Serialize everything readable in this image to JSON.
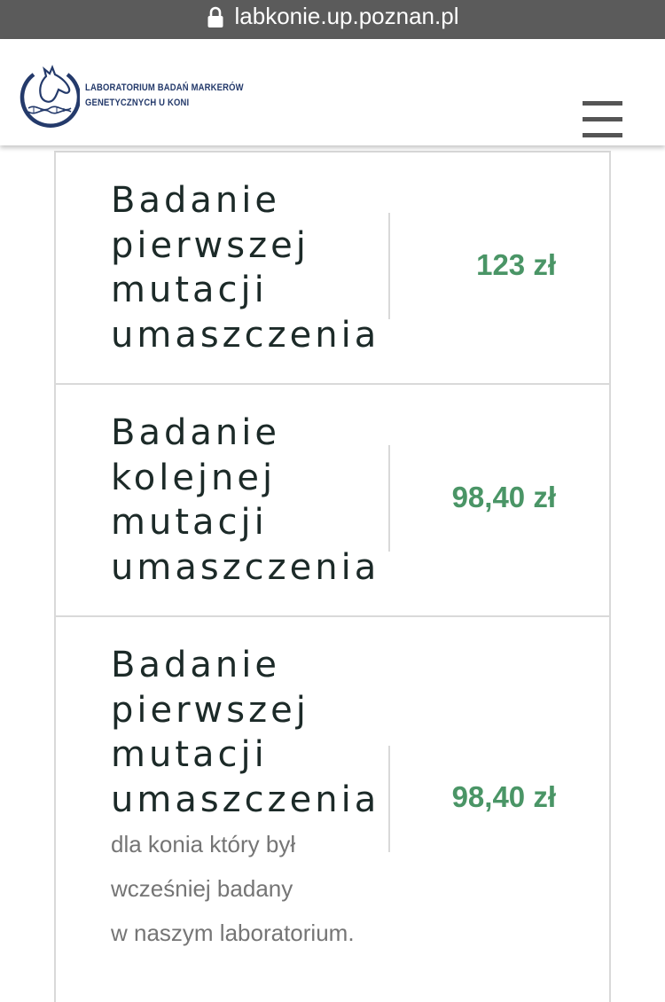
{
  "browser": {
    "url": "labkonie.up.poznan.pl"
  },
  "header": {
    "logo_line1": "LABORATORIUM BADAŃ MARKERÓW",
    "logo_line2": "GENETYCZNYCH U KONI"
  },
  "rows": [
    {
      "name_lines": [
        "Badanie",
        "pierwszej",
        "mutacji",
        "umaszczenia"
      ],
      "price": "123 zł"
    },
    {
      "name_lines": [
        "Badanie",
        "kolejnej",
        "mutacji",
        "umaszczenia"
      ],
      "price": "98,40 zł"
    },
    {
      "name_lines": [
        "Badanie",
        "pierwszej",
        "mutacji",
        "umaszczenia"
      ],
      "desc_lines": [
        "dla konia który był",
        "wcześniej badany",
        "w naszym laboratorium."
      ],
      "price": "98,40 zł"
    }
  ],
  "colors": {
    "accent_price": "#4a9566",
    "logo_blue": "#243a6b",
    "url_bar": "#5b5b5b"
  },
  "icons": {
    "lock": "lock-icon",
    "menu": "hamburger-menu-icon",
    "logo": "horse-logo-icon"
  }
}
